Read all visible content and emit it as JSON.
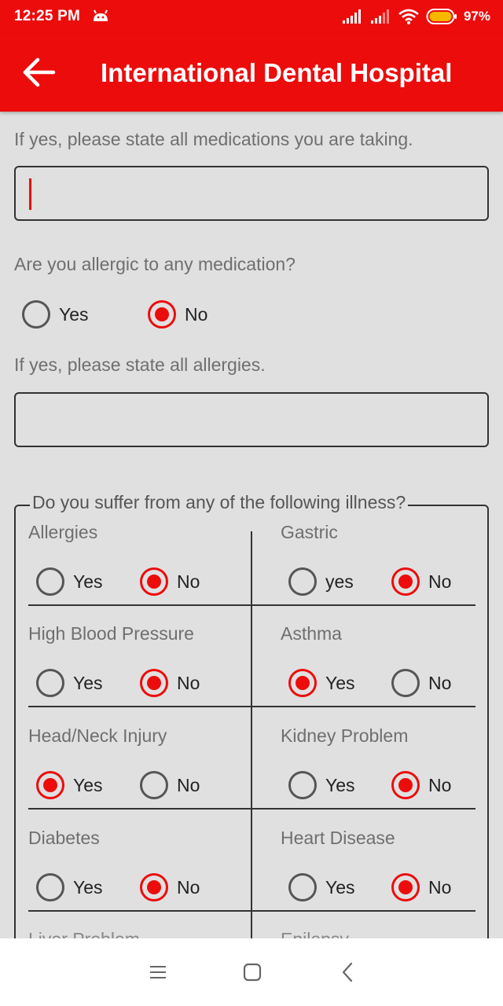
{
  "status_bar": {
    "time": "12:25 PM",
    "battery": "97%"
  },
  "app_bar": {
    "title": "International Dental Hospital"
  },
  "form": {
    "medications_label": "If yes, please state all medications you are taking.",
    "medications_value": "",
    "allergic_question": "Are you allergic to any medication?",
    "allergic_options": [
      "Yes",
      "No"
    ],
    "allergic_selected": "No",
    "allergies_label": "If yes, please state all allergies.",
    "allergies_value": ""
  },
  "illness_section": {
    "title": "Do you suffer from any of the following illness?",
    "items": [
      {
        "label": "Allergies",
        "yes": "Yes",
        "no": "No",
        "selected": "No"
      },
      {
        "label": "Gastric",
        "yes": "yes",
        "no": "No",
        "selected": "No"
      },
      {
        "label": "High Blood Pressure",
        "yes": "Yes",
        "no": "No",
        "selected": "No"
      },
      {
        "label": "Asthma",
        "yes": "Yes",
        "no": "No",
        "selected": "Yes"
      },
      {
        "label": "Head/Neck Injury",
        "yes": "Yes",
        "no": "No",
        "selected": "Yes"
      },
      {
        "label": "Kidney Problem",
        "yes": "Yes",
        "no": "No",
        "selected": "No"
      },
      {
        "label": "Diabetes",
        "yes": "Yes",
        "no": "No",
        "selected": "No"
      },
      {
        "label": "Heart Disease",
        "yes": "Yes",
        "no": "No",
        "selected": "No"
      },
      {
        "label": "Liver Problem"
      },
      {
        "label": "Epilepsy"
      }
    ]
  },
  "icons": {
    "back": "arrow-left-icon",
    "notification": "android-notification-icon",
    "signal": "signal-icon",
    "wifi": "wifi-icon",
    "battery": "battery-icon",
    "nav_menu": "menu-icon",
    "nav_home": "home-square-icon",
    "nav_back": "chevron-left-icon"
  },
  "colors": {
    "accent": "#ed0c0c",
    "background": "#e0e0e0",
    "nav_bar": "#ffffff"
  }
}
